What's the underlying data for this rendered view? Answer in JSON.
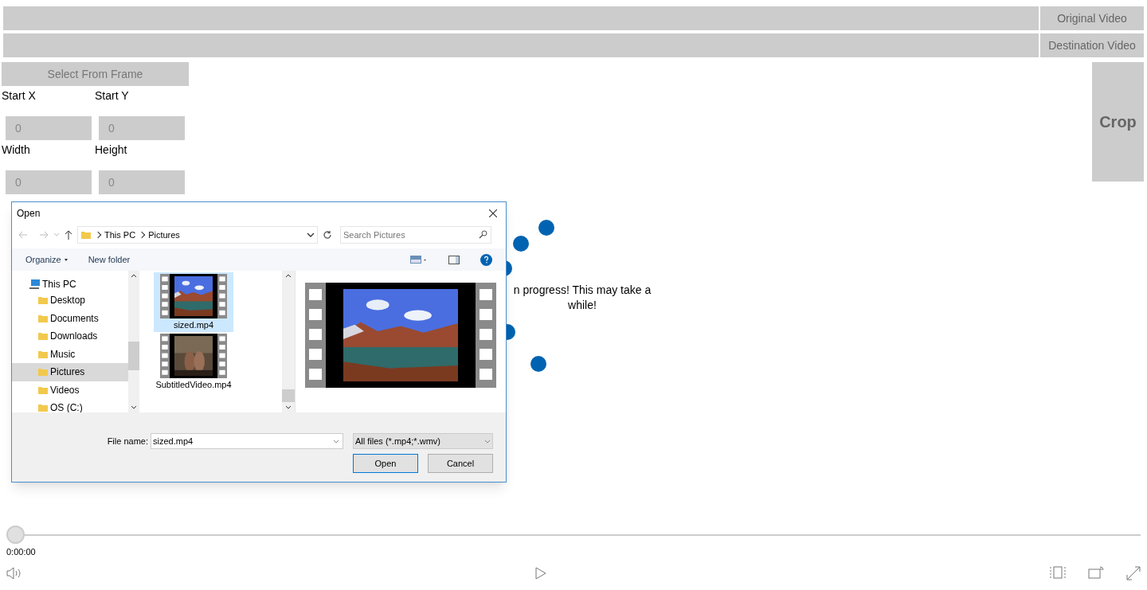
{
  "video_sources": [
    {
      "label": "Original Video"
    },
    {
      "label": "Destination Video"
    }
  ],
  "select_button": "Select From Frame",
  "fields": [
    {
      "label": "Start X",
      "value": "0"
    },
    {
      "label": "Start Y",
      "value": "0"
    },
    {
      "label": "Width",
      "value": "0"
    },
    {
      "label": "Height",
      "value": "0"
    }
  ],
  "crop_button": "Crop",
  "progress": {
    "message": "n progress! This may take a while!"
  },
  "dialog": {
    "title": "Open",
    "breadcrumb": [
      "This PC",
      "Pictures"
    ],
    "search_placeholder": "Search Pictures",
    "toolbar": [
      "Organize",
      "New folder"
    ],
    "tree": [
      {
        "label": "This PC",
        "selected": false,
        "children": [
          {
            "label": "Desktop",
            "selected": false
          },
          {
            "label": "Documents",
            "selected": false
          },
          {
            "label": "Downloads",
            "selected": false
          },
          {
            "label": "Music",
            "selected": false
          },
          {
            "label": "Pictures",
            "selected": true
          },
          {
            "label": "Videos",
            "selected": false
          },
          {
            "label": "OS (C:)",
            "selected": false
          }
        ]
      }
    ],
    "files": [
      {
        "name": "sized.mp4",
        "selected": true
      },
      {
        "name": "SubtitledVideo.mp4",
        "selected": false
      }
    ],
    "file_name_label": "File name:",
    "file_name": "sized.mp4",
    "filter": "All files (*.mp4;*.wmv)",
    "buttons": [
      {
        "label": "Open",
        "kind": "primary"
      },
      {
        "label": "Cancel",
        "kind": "secondary"
      }
    ]
  },
  "player": {
    "level": 0,
    "time": "0:00:00"
  }
}
